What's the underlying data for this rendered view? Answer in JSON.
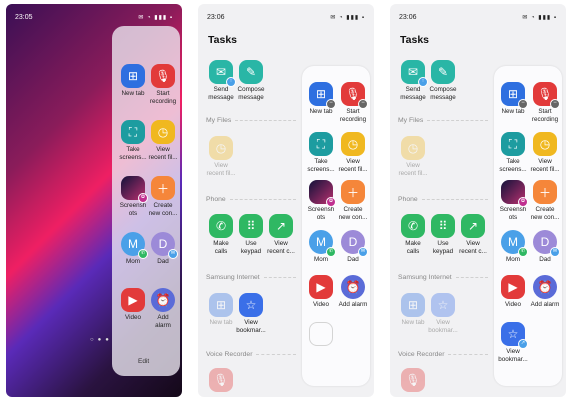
{
  "status_times": [
    "23:05",
    "23:06",
    "23:06"
  ],
  "status_icons": "✉ ◔ ▮▮▮ ▪",
  "colors": {
    "samsung_internet_blue": "#2e6fe0",
    "voice_recorder_red": "#e23a3a",
    "phone_green": "#2fb863",
    "background_gray": "#f1f1f3"
  },
  "screen1": {
    "panel_items": [
      {
        "label": "New tab",
        "icon": "new-tab-icon"
      },
      {
        "label": "Start\nrecording",
        "icon": "mic-icon"
      },
      {
        "label": "Take\nscreens...",
        "icon": "screenshot-icon"
      },
      {
        "label": "View\nrecent fil...",
        "icon": "recent-files-icon"
      },
      {
        "label": "Screensh\nots",
        "icon": "screenshots-icon"
      },
      {
        "label": "Create\nnew con...",
        "icon": "add-contact-icon"
      },
      {
        "label": "Mom",
        "icon": "contact-avatar-icon"
      },
      {
        "label": "Dad",
        "icon": "contact-avatar-icon"
      },
      {
        "label": "Video",
        "icon": "video-icon"
      },
      {
        "label": "Add\nalarm",
        "icon": "alarm-icon"
      }
    ],
    "edit_label": "Edit"
  },
  "tasks": {
    "title": "Tasks",
    "messages": [
      {
        "label": "Send\nmessage",
        "icon": "send-message-icon"
      },
      {
        "label": "Compose\nmessage",
        "icon": "compose-message-icon"
      }
    ],
    "my_files_label": "My Files",
    "my_files": [
      {
        "label": "View\nrecent fil...",
        "icon": "recent-files-icon"
      }
    ],
    "phone_label": "Phone",
    "phone": [
      {
        "label": "Make\ncalls",
        "icon": "call-icon"
      },
      {
        "label": "Use\nkeypad",
        "icon": "keypad-icon"
      },
      {
        "label": "View\nrecent c...",
        "icon": "recent-calls-icon"
      }
    ],
    "internet_label": "Samsung Internet",
    "internet": [
      {
        "label": "New tab",
        "icon": "new-tab-icon"
      },
      {
        "label": "View\nbookmar...",
        "icon": "bookmark-icon"
      }
    ],
    "voice_label": "Voice Recorder"
  },
  "panel_items": [
    {
      "label": "New tab",
      "icon": "new-tab-icon"
    },
    {
      "label": "Start\nrecording",
      "icon": "mic-icon"
    },
    {
      "label": "Take\nscreens...",
      "icon": "screenshot-icon"
    },
    {
      "label": "View\nrecent fil...",
      "icon": "recent-files-icon"
    },
    {
      "label": "Screensh\nots",
      "icon": "screenshots-icon"
    },
    {
      "label": "Create\nnew con...",
      "icon": "add-contact-icon"
    },
    {
      "label": "Mom",
      "icon": "contact-avatar-icon"
    },
    {
      "label": "Dad",
      "icon": "contact-avatar-icon"
    },
    {
      "label": "Video",
      "icon": "video-icon"
    },
    {
      "label": "Add alarm",
      "icon": "alarm-icon"
    }
  ],
  "screen3_extra": {
    "label": "View\nbookmar...",
    "icon": "bookmark-icon"
  }
}
